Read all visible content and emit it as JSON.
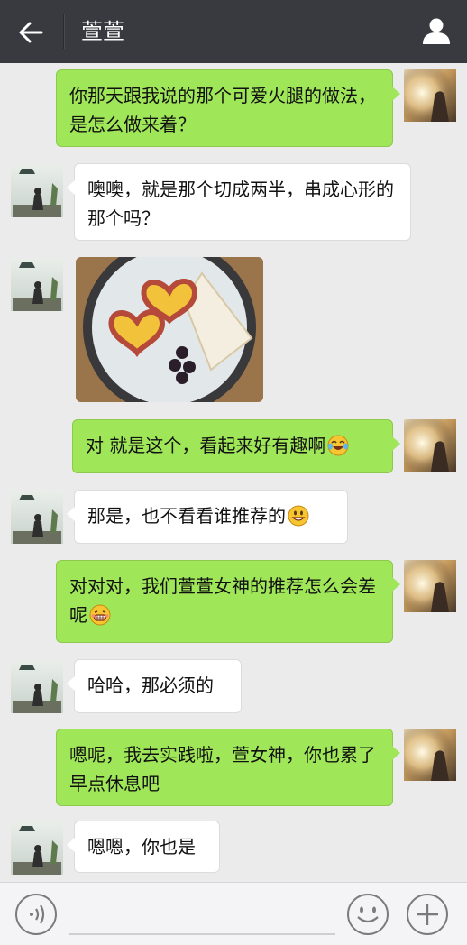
{
  "header": {
    "title": "萱萱"
  },
  "messages": [
    {
      "side": "right",
      "text": "你那天跟我说的那个可爱火腿的做法，是怎么做来着？"
    },
    {
      "side": "left",
      "text": "噢噢，就是那个切成两半，串成心形的那个吗？"
    },
    {
      "side": "left",
      "type": "image",
      "description": "heart-shaped sausage eggs with toast and grapes"
    },
    {
      "side": "right",
      "text": "对 就是这个，看起来好有趣啊",
      "emoji": "laugh-cry"
    },
    {
      "side": "left",
      "text": "那是，也不看看谁推荐的",
      "emoji": "smile"
    },
    {
      "side": "right",
      "text": "对对对，我们萱萱女神的推荐怎么会差呢",
      "emoji": "grin"
    },
    {
      "side": "left",
      "text": "哈哈，那必须的"
    },
    {
      "side": "right",
      "text": "嗯呢，我去实践啦，萱女神，你也累了早点休息吧"
    },
    {
      "side": "left",
      "text": "嗯嗯，你也是"
    }
  ],
  "colors": {
    "topbar": "#393a3f",
    "bubble_right": "#9fe658",
    "bubble_left": "#ffffff",
    "background": "#ebebeb"
  },
  "icons": {
    "back": "arrow-left-icon",
    "profile": "person-icon",
    "voice": "voice-icon",
    "emoji": "smiley-icon",
    "more": "plus-icon"
  }
}
